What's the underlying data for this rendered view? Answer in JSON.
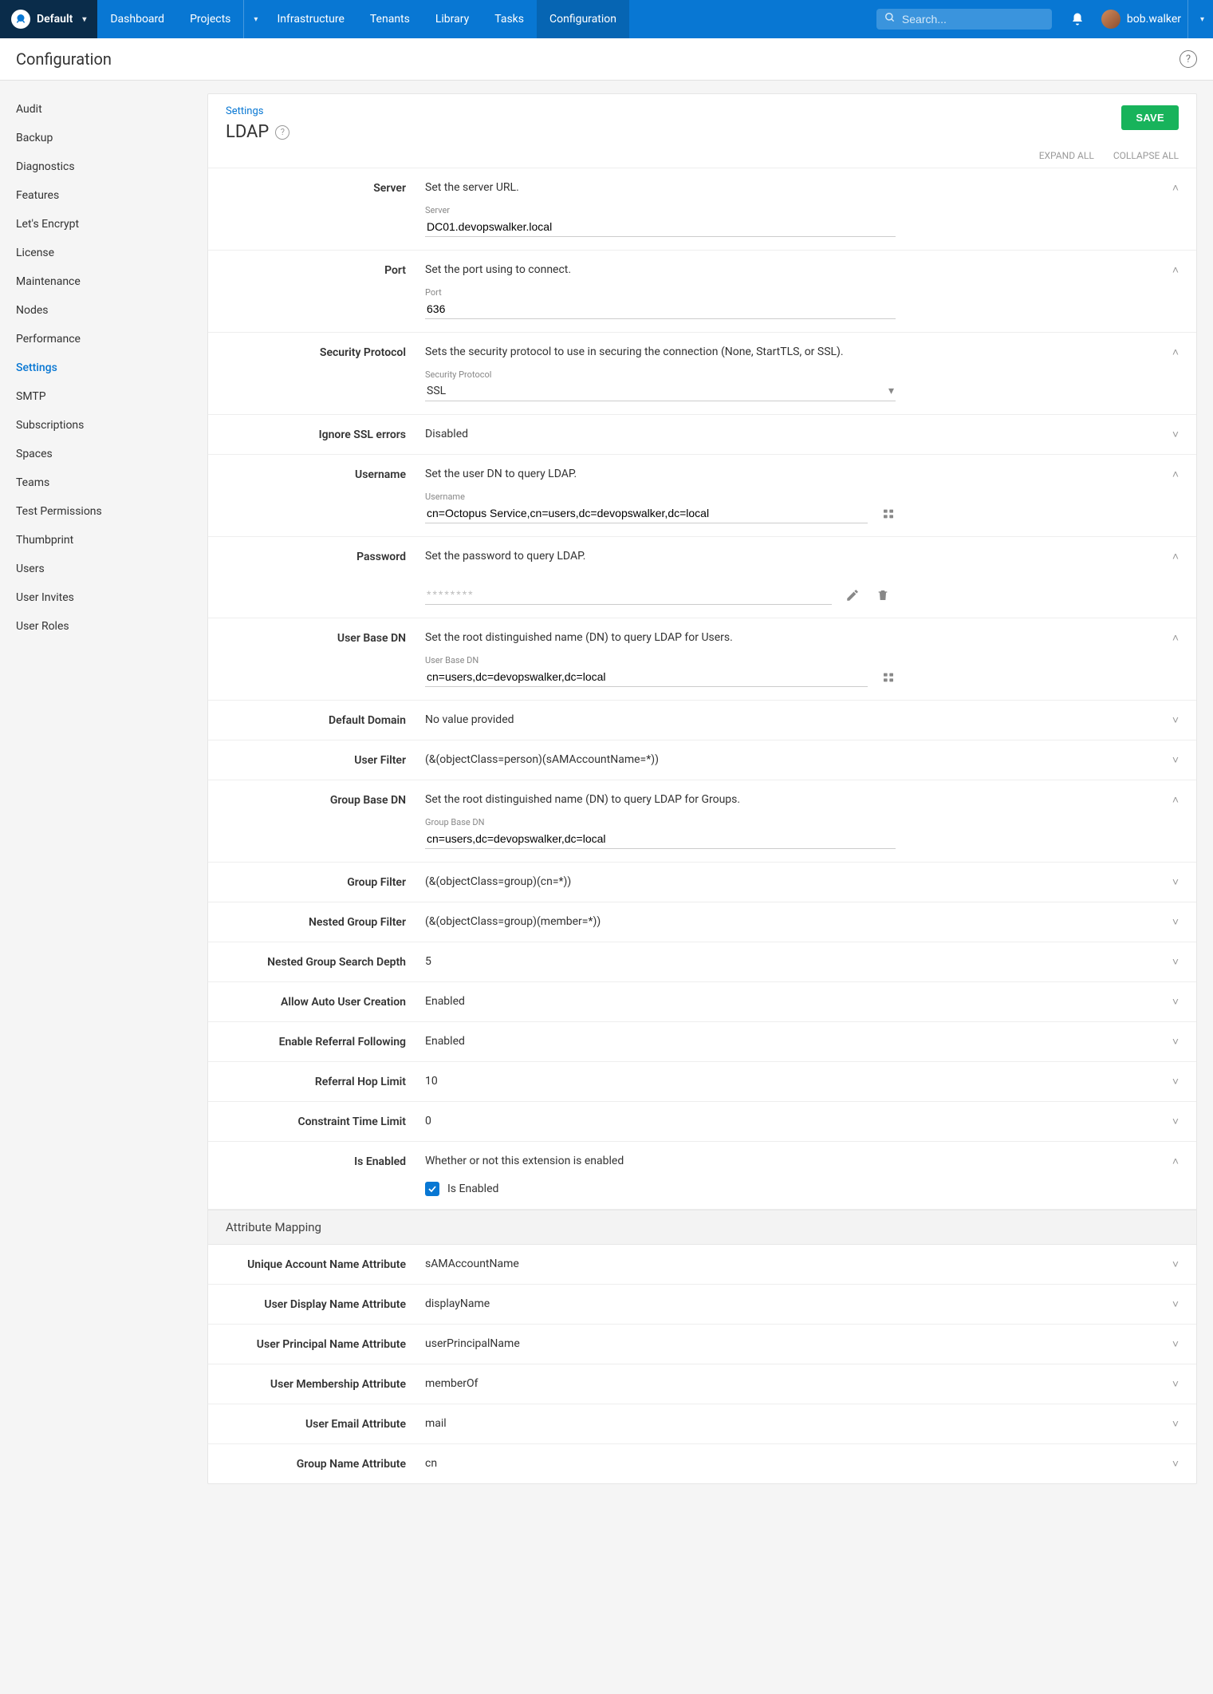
{
  "brand": {
    "space": "Default"
  },
  "nav": {
    "items": [
      "Dashboard",
      "Projects",
      "Infrastructure",
      "Tenants",
      "Library",
      "Tasks",
      "Configuration"
    ],
    "active": "Configuration"
  },
  "search": {
    "placeholder": "Search..."
  },
  "user": {
    "name": "bob.walker"
  },
  "subheader": {
    "title": "Configuration"
  },
  "sidebar": {
    "items": [
      "Audit",
      "Backup",
      "Diagnostics",
      "Features",
      "Let's Encrypt",
      "License",
      "Maintenance",
      "Nodes",
      "Performance",
      "Settings",
      "SMTP",
      "Subscriptions",
      "Spaces",
      "Teams",
      "Test Permissions",
      "Thumbprint",
      "Users",
      "User Invites",
      "User Roles"
    ],
    "active": "Settings"
  },
  "page": {
    "breadcrumb": "Settings",
    "title": "LDAP",
    "save": "SAVE",
    "expand_all": "EXPAND ALL",
    "collapse_all": "COLLAPSE ALL",
    "attribute_mapping": "Attribute Mapping"
  },
  "rows": {
    "server": {
      "label": "Server",
      "desc": "Set the server URL.",
      "flabel": "Server",
      "value": "DC01.devopswalker.local"
    },
    "port": {
      "label": "Port",
      "desc": "Set the port using to connect.",
      "flabel": "Port",
      "value": "636"
    },
    "sec": {
      "label": "Security Protocol",
      "desc": "Sets the security protocol to use in securing the connection (None, StartTLS, or SSL).",
      "flabel": "Security Protocol",
      "value": "SSL"
    },
    "ignoressl": {
      "label": "Ignore SSL errors",
      "value": "Disabled"
    },
    "username": {
      "label": "Username",
      "desc": "Set the user DN to query LDAP.",
      "flabel": "Username",
      "value": "cn=Octopus Service,cn=users,dc=devopswalker,dc=local"
    },
    "password": {
      "label": "Password",
      "desc": "Set the password to query LDAP.",
      "placeholder": "********"
    },
    "userbasedn": {
      "label": "User Base DN",
      "desc": "Set the root distinguished name (DN) to query LDAP for Users.",
      "flabel": "User Base DN",
      "value": "cn=users,dc=devopswalker,dc=local"
    },
    "defaultdomain": {
      "label": "Default Domain",
      "value": "No value provided"
    },
    "userfilter": {
      "label": "User Filter",
      "value": "(&(objectClass=person)(sAMAccountName=*))"
    },
    "groupbasedn": {
      "label": "Group Base DN",
      "desc": "Set the root distinguished name (DN) to query LDAP for Groups.",
      "flabel": "Group Base DN",
      "value": "cn=users,dc=devopswalker,dc=local"
    },
    "groupfilter": {
      "label": "Group Filter",
      "value": "(&(objectClass=group)(cn=*))"
    },
    "nestedgroupfilter": {
      "label": "Nested Group Filter",
      "value": "(&(objectClass=group)(member=*))"
    },
    "nesteddepth": {
      "label": "Nested Group Search Depth",
      "value": "5"
    },
    "autouser": {
      "label": "Allow Auto User Creation",
      "value": "Enabled"
    },
    "referral": {
      "label": "Enable Referral Following",
      "value": "Enabled"
    },
    "hoplimit": {
      "label": "Referral Hop Limit",
      "value": "10"
    },
    "timelimit": {
      "label": "Constraint Time Limit",
      "value": "0"
    },
    "enabled": {
      "label": "Is Enabled",
      "desc": "Whether or not this extension is enabled",
      "checkbox": "Is Enabled"
    },
    "attr_unique": {
      "label": "Unique Account Name Attribute",
      "value": "sAMAccountName"
    },
    "attr_display": {
      "label": "User Display Name Attribute",
      "value": "displayName"
    },
    "attr_principal": {
      "label": "User Principal Name Attribute",
      "value": "userPrincipalName"
    },
    "attr_member": {
      "label": "User Membership Attribute",
      "value": "memberOf"
    },
    "attr_email": {
      "label": "User Email Attribute",
      "value": "mail"
    },
    "attr_group": {
      "label": "Group Name Attribute",
      "value": "cn"
    }
  }
}
